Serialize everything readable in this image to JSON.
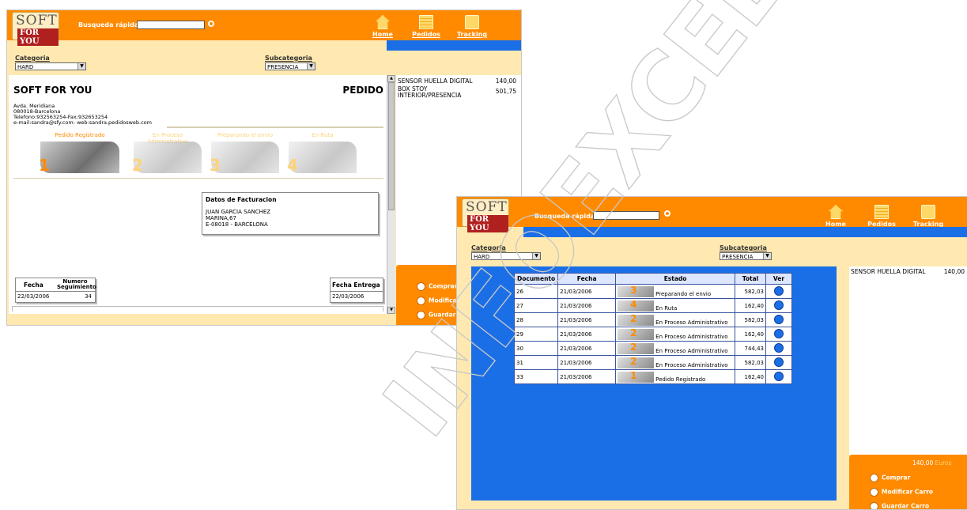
{
  "brand": {
    "logo_top": "SOFT",
    "logo_bottom": "FOR YOU"
  },
  "header": {
    "search_label": "Busqueda rápida",
    "nav": [
      "Home",
      "Pedidos",
      "Tracking"
    ]
  },
  "filters": {
    "category_label": "Categoria",
    "category_value": "HARD",
    "subcategory_label": "Subcategoria",
    "subcategory_value": "PRESENCIA"
  },
  "window1": {
    "company": "SOFT FOR YOU",
    "doc_title": "PEDIDO",
    "address": [
      "Avda. Meridiana",
      "080018-Barcelona",
      "Telefono:932563254-Fax:932653254",
      "e-mail:sandra@sfy.com- web:sandra.pedidosweb.com"
    ],
    "steps": [
      {
        "title": "Pedido Registrado",
        "num": "1"
      },
      {
        "title": "En Proceso Administrativo",
        "num": "2"
      },
      {
        "title": "Preparando el envio",
        "num": "3"
      },
      {
        "title": "En Ruta",
        "num": "4"
      }
    ],
    "billing": {
      "title": "Datos de Facturacion",
      "lines": [
        "JUAN GARCIA SANCHEZ",
        "MARINA,67",
        "E-08018 - BARCELONA"
      ]
    },
    "tracking": {
      "fecha_label": "Fecha",
      "numero_label_1": "Numero",
      "numero_label_2": "Seguimiento",
      "fecha": "22/03/2006",
      "numero": "34"
    },
    "entrega": {
      "label": "Fecha Entrega",
      "value": "22/03/2006"
    },
    "cart": [
      {
        "name": "SENSOR HUELLA DIGITAL",
        "price": "140,00"
      },
      {
        "name": "BOX STOY INTERIOR/PRESENCIA",
        "price": "501,75"
      }
    ],
    "actions": [
      "Comprar",
      "Modificar C",
      "Guardar C"
    ]
  },
  "window2": {
    "columns": [
      "Documento",
      "Fecha",
      "Estado",
      "Total",
      "Ver"
    ],
    "rows": [
      {
        "doc": "26",
        "fecha": "21/03/2006",
        "num": "3",
        "estado": "Preparando el envio",
        "total": "582,03"
      },
      {
        "doc": "27",
        "fecha": "21/03/2006",
        "num": "4",
        "estado": "En Ruta",
        "total": "162,40"
      },
      {
        "doc": "28",
        "fecha": "21/03/2006",
        "num": "2",
        "estado": "En Proceso Administrativo",
        "total": "582,03"
      },
      {
        "doc": "29",
        "fecha": "21/03/2006",
        "num": "2",
        "estado": "En Proceso Administrativo",
        "total": "162,40"
      },
      {
        "doc": "30",
        "fecha": "21/03/2006",
        "num": "2",
        "estado": "En Proceso Administrativo",
        "total": "744,43"
      },
      {
        "doc": "31",
        "fecha": "21/03/2006",
        "num": "2",
        "estado": "En Proceso Administrativo",
        "total": "582,03"
      },
      {
        "doc": "33",
        "fecha": "21/03/2006",
        "num": "1",
        "estado": "Pedido Registrado",
        "total": "162,40"
      }
    ],
    "cart": [
      {
        "name": "SENSOR HUELLA DIGITAL",
        "price": "140,00"
      }
    ],
    "total": "140,00",
    "currency": "Euros",
    "actions": [
      "Comprar",
      "Modificar Carro",
      "Guardar Carro"
    ]
  },
  "watermark": "INFOEXCEL.COM",
  "colors": {
    "orange": "#ff8a00",
    "blue": "#1b6fe6",
    "cream": "#ffe9b0"
  }
}
